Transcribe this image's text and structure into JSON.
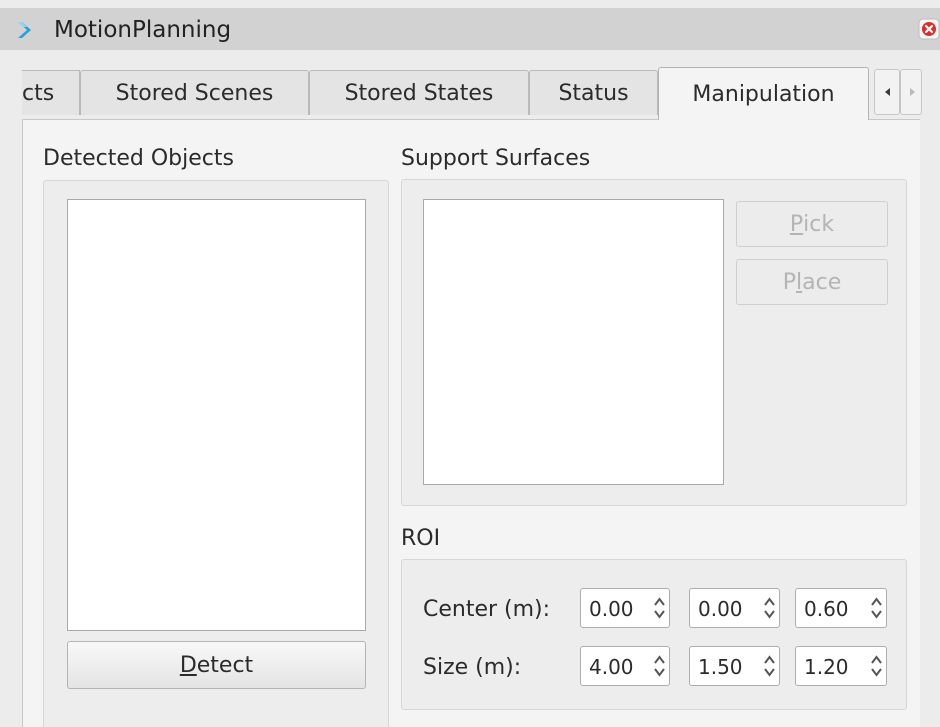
{
  "window": {
    "title": "MotionPlanning",
    "app_icon": "rviz-chevron-icon",
    "close_icon": "close-icon"
  },
  "tabs": {
    "items": [
      {
        "label": "cts"
      },
      {
        "label": "Stored Scenes"
      },
      {
        "label": "Stored States"
      },
      {
        "label": "Status"
      },
      {
        "label": "Manipulation"
      }
    ],
    "active_index": 4
  },
  "detected_objects": {
    "heading": "Detected Objects",
    "detect_button": {
      "label_mnemonic": "D",
      "label_rest": "etect"
    }
  },
  "support_surfaces": {
    "heading": "Support Surfaces",
    "pick_button": {
      "label_mnemonic": "P",
      "label_rest": "ick",
      "enabled": false
    },
    "place_button": {
      "label_pre": "P",
      "label_mnemonic": "l",
      "label_rest": "ace",
      "enabled": false
    }
  },
  "roi": {
    "heading": "ROI",
    "center": {
      "label": "Center (m):",
      "values": [
        "0.00",
        "0.00",
        "0.60"
      ]
    },
    "size": {
      "label": "Size (m):",
      "values": [
        "4.00",
        "1.50",
        "1.20"
      ]
    }
  },
  "colors": {
    "titlebar": "#d2d2d2",
    "panel": "#f4f4f4",
    "disabled_text": "#b4b4b4",
    "close_red": "#d9302c"
  }
}
